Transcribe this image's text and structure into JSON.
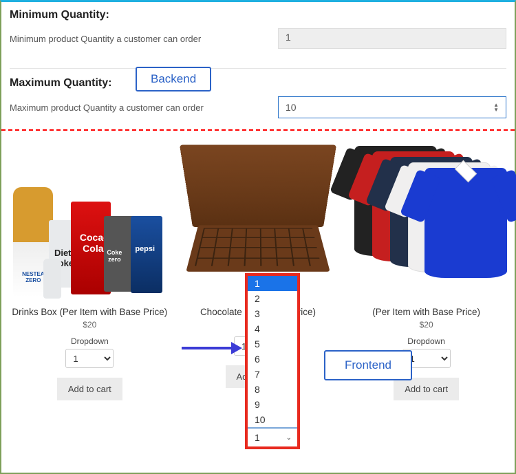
{
  "backend": {
    "min": {
      "title": "Minimum Quantity:",
      "hint": "Minimum product Quantity a customer can order",
      "value": "1"
    },
    "max": {
      "title": "Maximum Quantity:",
      "hint": "Maximum product Quantity a customer can order",
      "value": "10"
    },
    "badge": "Backend"
  },
  "frontend": {
    "badge": "Frontend",
    "control_label": "Dropdown",
    "add_to_cart": "Add to cart",
    "qty_options": [
      "1",
      "2",
      "3",
      "4",
      "5",
      "6",
      "7",
      "8",
      "9",
      "10"
    ],
    "selected_qty": "1",
    "products": [
      {
        "name": "Drinks Box (Per Item with Base Price)",
        "price": "$20"
      },
      {
        "name": "Chocolate Box (Fixed Price)",
        "price": ""
      },
      {
        "name": "(Per Item with Base Price)",
        "price": "$20"
      }
    ]
  },
  "dropdown_popup": {
    "options": [
      "1",
      "2",
      "3",
      "4",
      "5",
      "6",
      "7",
      "8",
      "9",
      "10"
    ],
    "selected": "1",
    "footer_value": "1"
  }
}
